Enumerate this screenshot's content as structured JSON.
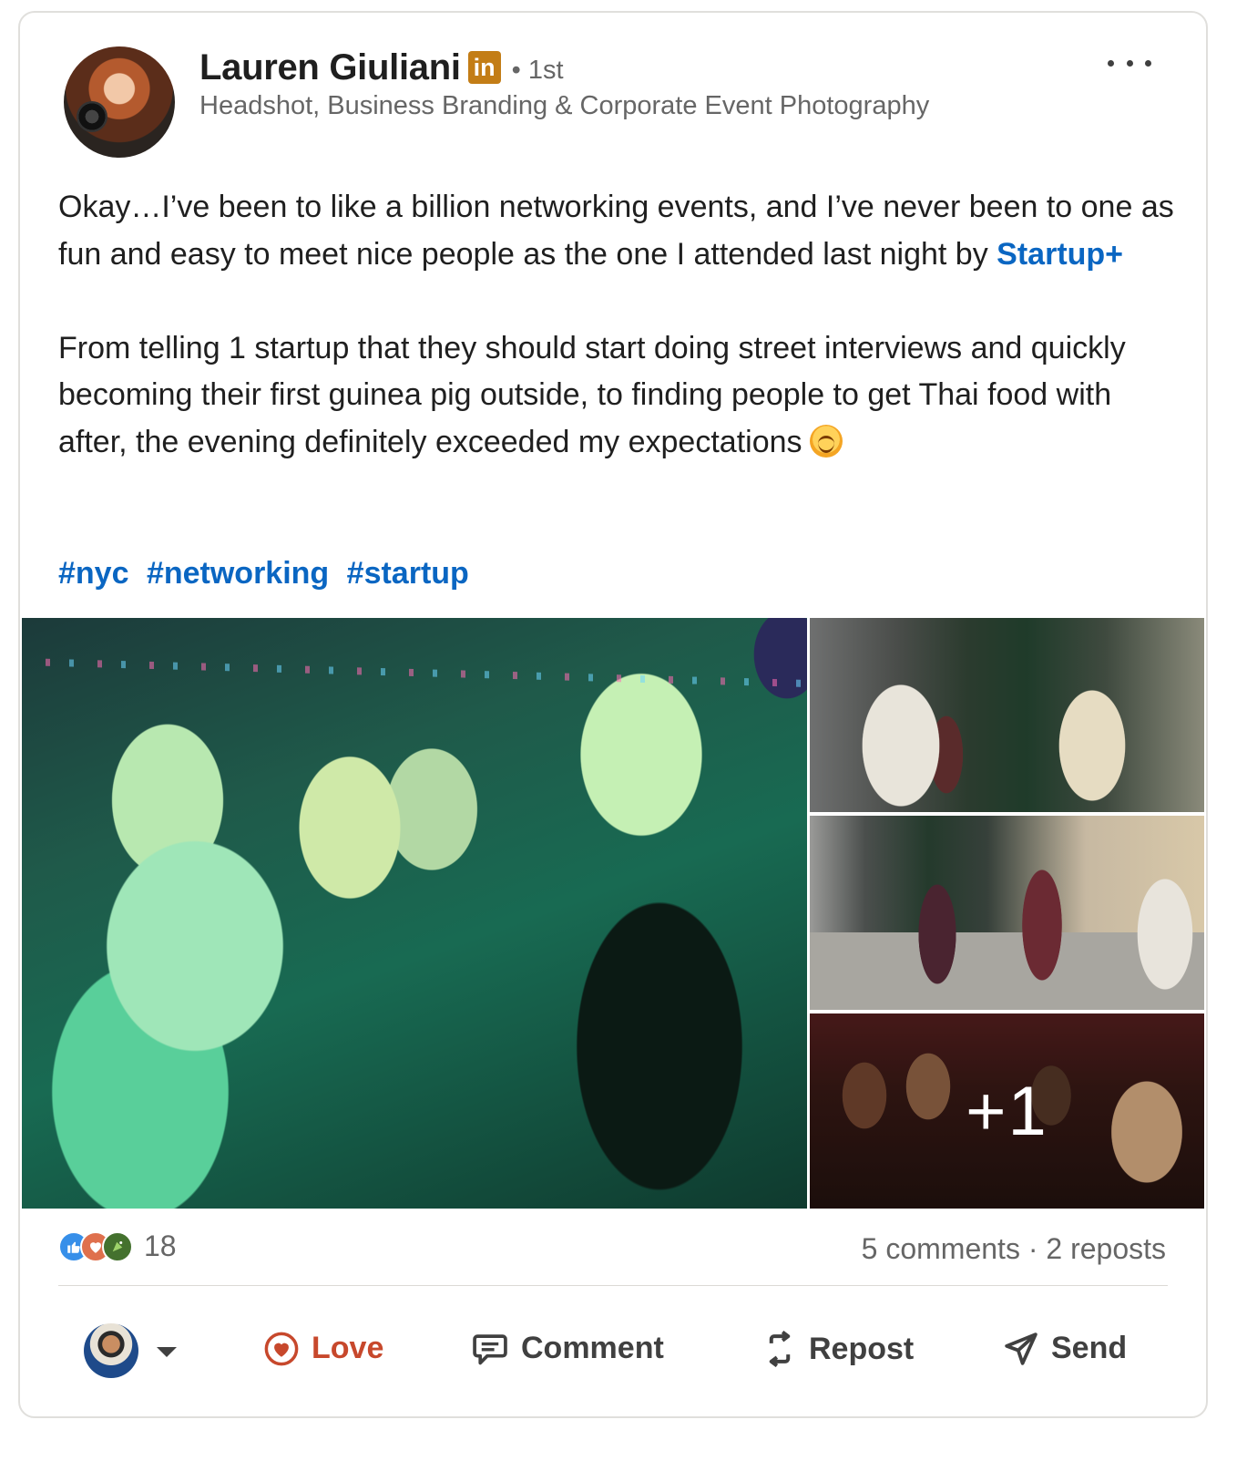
{
  "author": {
    "name": "Lauren Giuliani",
    "badge": "in",
    "degree": "• 1st",
    "headline": "Headshot, Business Branding & Corporate Event Photography"
  },
  "post": {
    "p1_before": "Okay…I’ve been to like a billion networking events, and I’ve never been to one as fun and easy to meet nice people as the one I attended last night by ",
    "p1_link": "Startup+",
    "p2": "From telling 1 startup that they should start doing street interviews and quickly becoming their first guinea pig outside, to finding people to get Thai food with after, the evening definitely exceeded my expectations",
    "hashtags": [
      "#nyc",
      "#networking",
      "#startup"
    ]
  },
  "media": {
    "more_count": "+1"
  },
  "social": {
    "reaction_count": "18",
    "comments": "5 comments",
    "separator": " · ",
    "reposts": "2 reposts"
  },
  "actions": {
    "love": "Love",
    "comment": "Comment",
    "repost": "Repost",
    "send": "Send"
  },
  "colors": {
    "link": "#0a66c2",
    "love": "#c7482c",
    "badge": "#c37d16"
  }
}
